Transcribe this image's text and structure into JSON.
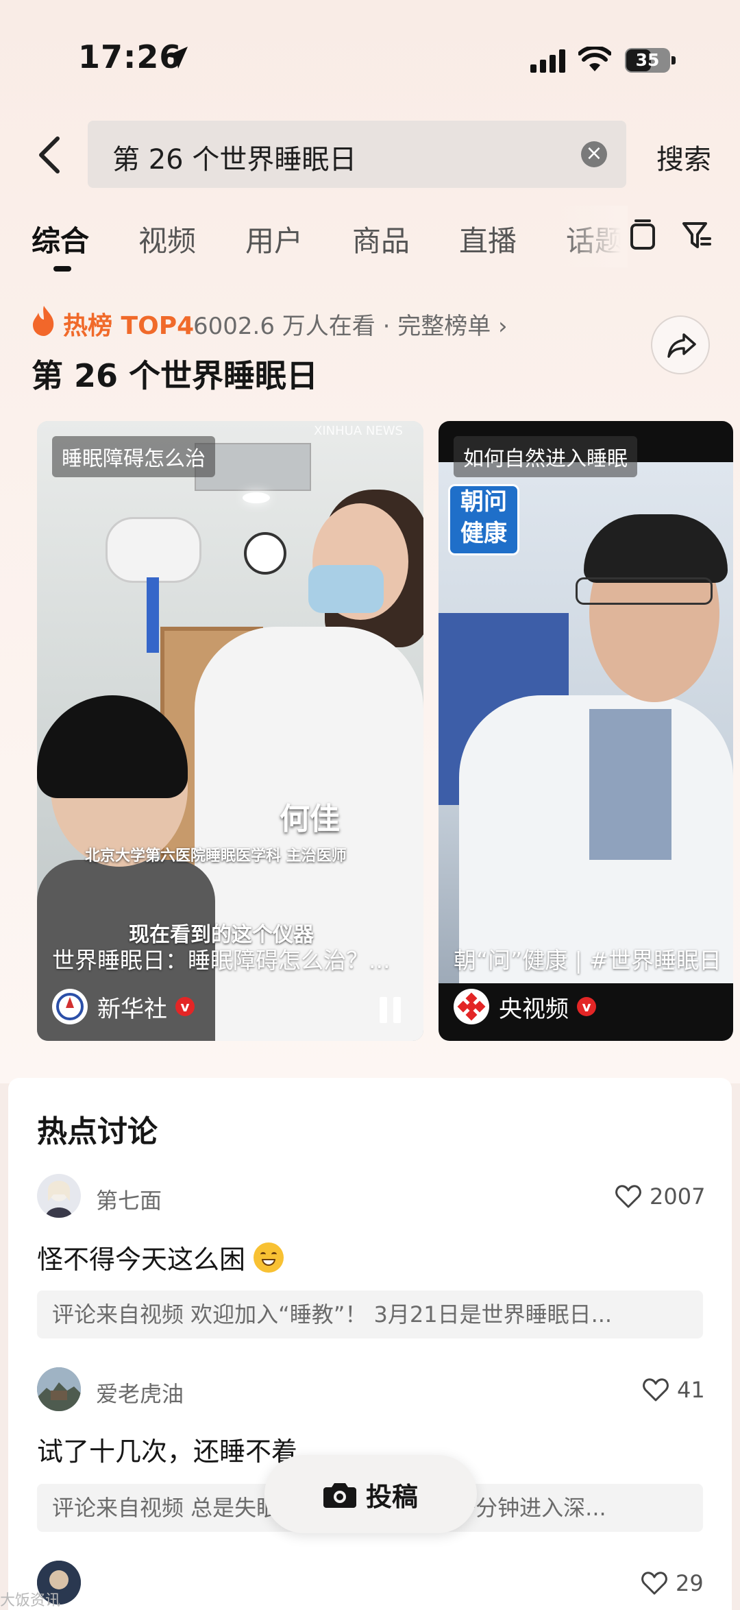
{
  "status_bar": {
    "time": "17:26",
    "battery": "35"
  },
  "search": {
    "query": "第 26 个世界睡眠日",
    "button_label": "搜索"
  },
  "tabs": [
    {
      "label": "综合"
    },
    {
      "label": "视频"
    },
    {
      "label": "用户"
    },
    {
      "label": "商品"
    },
    {
      "label": "直播"
    },
    {
      "label": "话题"
    }
  ],
  "hot": {
    "label": "热榜 TOP4",
    "meta": "6002.6 万人在看 · 完整榜单 ›",
    "title": "第 26 个世界睡眠日"
  },
  "videos": [
    {
      "tag": "睡眠障碍怎么治",
      "watermark": "XINHUA NEWS",
      "scene_name": "何佳",
      "scene_sub": "北京大学第六医院睡眠医学科 主治医师",
      "scene_line": "现在看到的这个仪器",
      "caption": "世界睡眠日：睡眠障碍怎么治？...",
      "author": "新华社"
    },
    {
      "tag": "如何自然进入睡眠",
      "badge_top": "朝问",
      "badge_bottom": "健康",
      "caption": "朝“问”健康 | #世界睡眠日",
      "author": "央视频"
    }
  ],
  "discussion": {
    "title": "热点讨论",
    "comments": [
      {
        "user": "第七面",
        "likes": "2007",
        "text": "怪不得今天这么困",
        "source": "评论来自视频  欢迎加入“睡教”！ 3月21日是世界睡眠日..."
      },
      {
        "user": "爱老虎油",
        "likes": "41",
        "text": "试了十几次，还睡不着",
        "source": "评论来自视频  总是失眠？试试这个方法，一分钟进入深..."
      },
      {
        "user": "",
        "likes": "29",
        "text": "",
        "source": ""
      }
    ]
  },
  "post_button": {
    "label": "投稿"
  },
  "footer_mark": "大饭资讯",
  "colors": {
    "accent": "#f06a2a",
    "verified": "#e32626"
  }
}
